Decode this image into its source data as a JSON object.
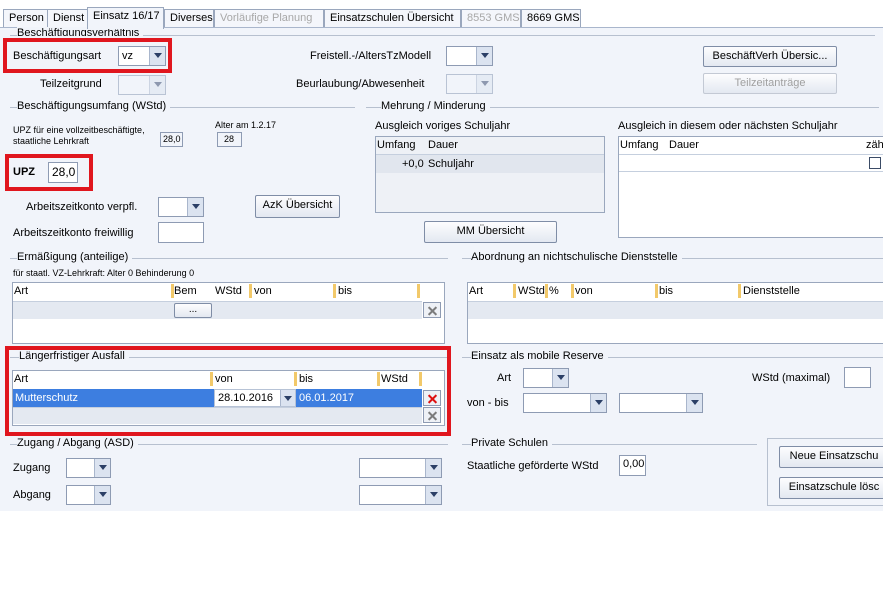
{
  "tabs": [
    "Person",
    "Dienst",
    "Einsatz 16/17",
    "Diverses",
    "Vorläufige Planung",
    "Einsatzschulen Übersicht",
    "8553 GMS",
    "8669 GMS"
  ],
  "sections": {
    "beschaeftigungsverhaeltnis": "Beschäftigungsverhältnis",
    "umfang": "Beschäftigungsumfang (WStd)",
    "mehrung": "Mehrung / Minderung",
    "ermaessigung": "Ermäßigung (anteilige)",
    "abordnung": "Abordnung an nichtschulische Dienststelle",
    "ausfall": "Längerfristiger Ausfall",
    "mobile": "Einsatz als mobile Reserve",
    "zugang": "Zugang / Abgang (ASD)",
    "privat": "Private Schulen"
  },
  "besch": {
    "art_label": "Beschäftigungsart",
    "art_value": "vz",
    "teilzeitgrund_label": "Teilzeitgrund",
    "freistell_label": "Freistell.-/AltersTzModell",
    "beurlaubung_label": "Beurlaubung/Abwesenheit",
    "btn_verh": "BeschäftVerh Übersic...",
    "btn_teilzeit": "Teilzeitanträge"
  },
  "umfang": {
    "upz_note": "UPZ für eine vollzeitbeschäftigte, staatliche Lehrkraft",
    "upz_note_value": "28,0",
    "alter_label": "Alter am 1.2.17",
    "alter_value": "28",
    "upz_label": "UPZ",
    "upz_value": "28,0",
    "azk_verpfl": "Arbeitszeitkonto verpfl.",
    "azk_frei": "Arbeitszeitkonto freiwillig",
    "btn_azk": "AzK Übersicht"
  },
  "mehrung": {
    "left_title": "Ausgleich voriges Schuljahr",
    "right_title": "Ausgleich in diesem oder nächsten Schuljahr",
    "col_umfang": "Umfang",
    "col_dauer": "Dauer",
    "col_zaeh": "zäh",
    "row_umfang": "+0,0",
    "row_dauer": "Schuljahr",
    "btn_mm": "MM Übersicht"
  },
  "ermaessigung": {
    "note": "für staatl. VZ-Lehrkraft: Alter 0 Behinderung 0",
    "cols": [
      "Art",
      "Bem",
      "WStd",
      "von",
      "bis"
    ],
    "bem_btn": "..."
  },
  "abordnung": {
    "cols": [
      "Art",
      "WStd",
      "%",
      "von",
      "bis",
      "Dienststelle"
    ]
  },
  "ausfall": {
    "cols": [
      "Art",
      "von",
      "bis",
      "WStd"
    ],
    "rows": [
      {
        "art": "Mutterschutz",
        "von": "28.10.2016",
        "bis": "06.01.2017",
        "wstd": ""
      }
    ]
  },
  "mobile": {
    "art_label": "Art",
    "vonbis_label": "von - bis",
    "wstd_label": "WStd (maximal)"
  },
  "zugang": {
    "zugang_label": "Zugang",
    "abgang_label": "Abgang"
  },
  "privat": {
    "label": "Staatliche geförderte WStd",
    "value": "0,00",
    "btn_neu": "Neue Einsatzschu",
    "btn_loesch": "Einsatzschule lösc"
  }
}
